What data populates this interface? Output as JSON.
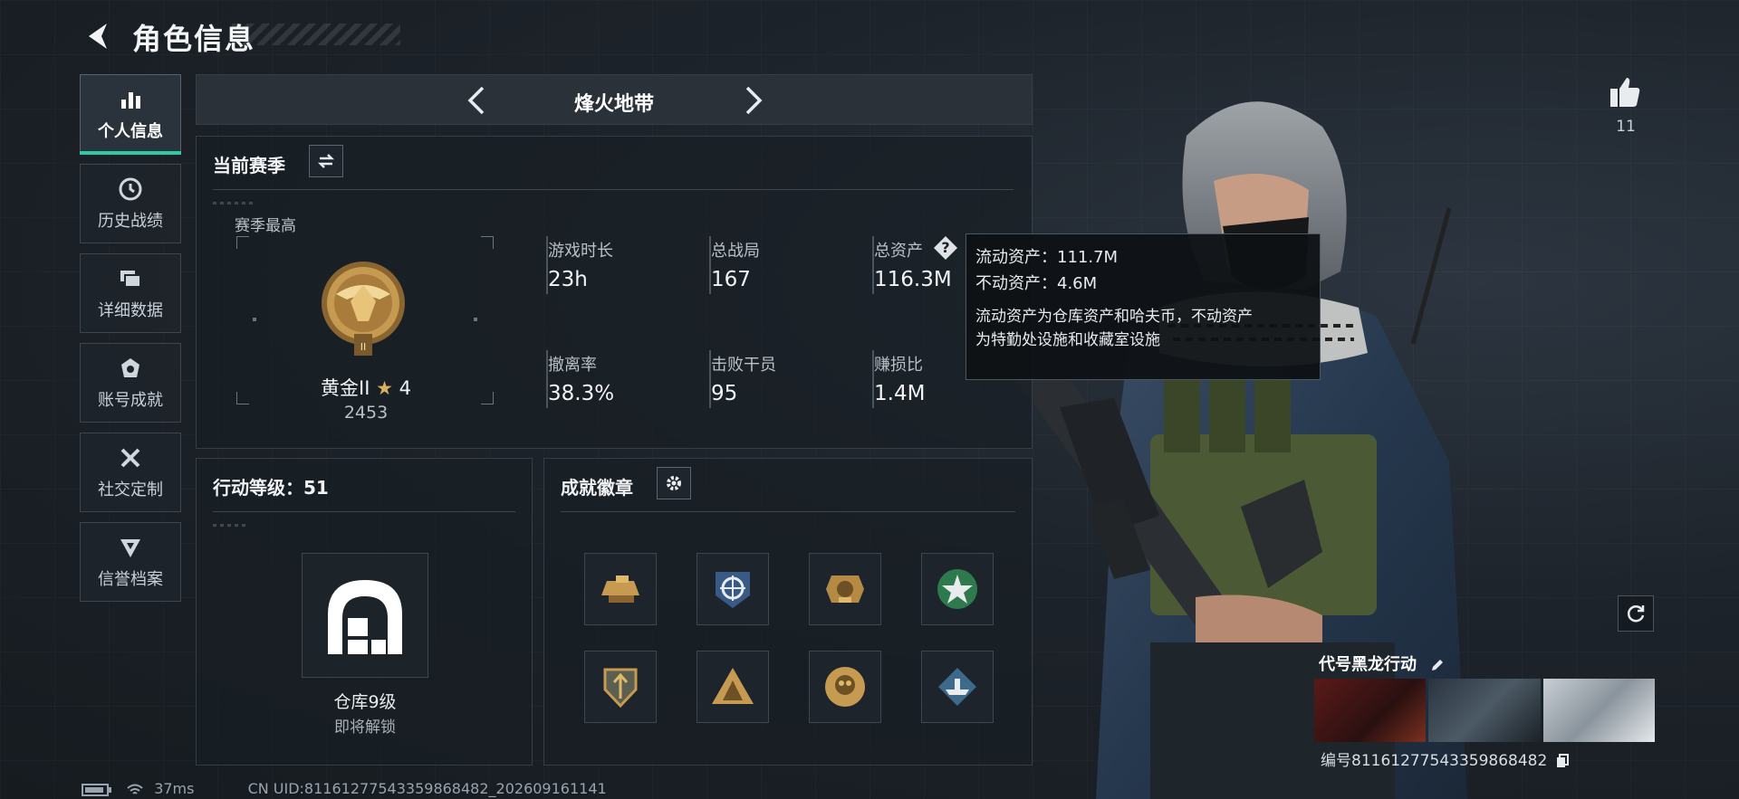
{
  "header": {
    "title": "角色信息"
  },
  "sidebar": {
    "items": [
      {
        "label": "个人信息",
        "icon": "bar-chart-icon",
        "active": true
      },
      {
        "label": "历史战绩",
        "icon": "history-clock-icon"
      },
      {
        "label": "详细数据",
        "icon": "folders-icon"
      },
      {
        "label": "账号成就",
        "icon": "medal-icon"
      },
      {
        "label": "社交定制",
        "icon": "tools-icon"
      },
      {
        "label": "信誉档案",
        "icon": "shield-icon"
      }
    ]
  },
  "mode": {
    "title": "烽火地带"
  },
  "season": {
    "heading": "当前赛季",
    "best_label": "赛季最高",
    "rank_name": "黄金II",
    "rank_stars": "4",
    "rank_points": "2453",
    "stats": [
      {
        "label": "游戏时长",
        "value": "23h"
      },
      {
        "label": "总战局",
        "value": "167"
      },
      {
        "label": "总资产",
        "value": "116.3M"
      },
      {
        "label": "撤离率",
        "value": "38.3%"
      },
      {
        "label": "击败干员",
        "value": "95"
      },
      {
        "label": "赚损比",
        "value": "1.4M"
      }
    ]
  },
  "tooltip": {
    "liquid": "流动资产：111.7M",
    "fixed": "不动资产：4.6M",
    "desc_line1": "流动资产为仓库资产和哈夫币，不动资产",
    "desc_line2": "为特勤处设施和收藏室设施"
  },
  "action_level": {
    "heading": "行动等级：51",
    "unlock_title": "仓库9级",
    "unlock_sub": "即将解锁"
  },
  "badges": {
    "heading": "成就徽章",
    "items": [
      "tank-badge-icon",
      "crosshair-badge-icon",
      "eagle-badge-icon",
      "star-badge-icon",
      "shield-badge-icon",
      "soldiers-badge-icon",
      "skull-badge-icon",
      "ship-badge-icon"
    ]
  },
  "likes": {
    "count": "11"
  },
  "banner": {
    "label": "代号黑龙行动",
    "id": "编号811612775433598684​82"
  },
  "footer": {
    "ping": "37ms",
    "uid": "CN UID:811612775433598684​82_202609161141"
  },
  "colors": {
    "accent": "#2fc9a3",
    "gold": "#c79a52",
    "panel": "#181e24"
  }
}
